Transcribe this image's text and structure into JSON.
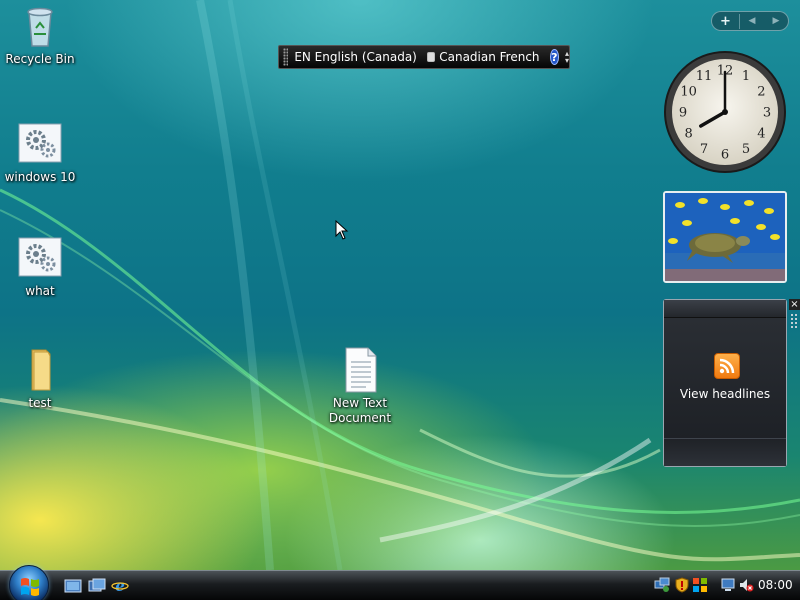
{
  "desktop": {
    "icons": [
      {
        "label": "Recycle Bin"
      },
      {
        "label": "windows 10"
      },
      {
        "label": "what"
      },
      {
        "label": "test"
      },
      {
        "label": "New Text Document"
      }
    ]
  },
  "language_bar": {
    "language": "EN English (Canada)",
    "keyboard_layout": "Canadian French",
    "help_glyph": "?"
  },
  "sidebar": {
    "add_glyph": "+",
    "prev_glyph": "◀",
    "next_glyph": "▶"
  },
  "clock": {
    "time": "08:00",
    "numerals": [
      "12",
      "1",
      "2",
      "3",
      "4",
      "5",
      "6",
      "7",
      "8",
      "9",
      "10",
      "11"
    ]
  },
  "feed_gadget": {
    "label": "View headlines",
    "close_glyph": "×"
  },
  "taskbar": {
    "clock_time": "08:00",
    "quick_launch": [
      "show-desktop-icon",
      "switch-windows-icon",
      "internet-explorer-icon"
    ],
    "tray_icons": [
      "network-icon",
      "security-shield-icon",
      "windows-update-icon",
      "network-disconnected-icon",
      "volume-muted-icon"
    ]
  },
  "colors": {
    "taskbar": "#101214",
    "accent": "#2f7fc9",
    "rss": "#f28a1c"
  }
}
